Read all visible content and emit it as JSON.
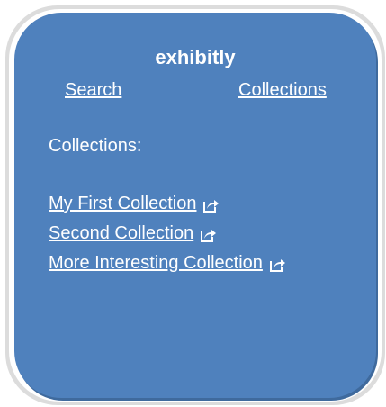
{
  "app": {
    "title": "exhibitly"
  },
  "nav": {
    "search_label": "Search",
    "collections_label": "Collections"
  },
  "section": {
    "label": "Collections:"
  },
  "collections": [
    {
      "label": "My First Collection",
      "icon": "external-link-icon"
    },
    {
      "label": "Second Collection",
      "icon": "external-link-icon"
    },
    {
      "label": "More Interesting Collection",
      "icon": "external-link-icon"
    }
  ],
  "colors": {
    "panel": "#4f81bd",
    "text": "#ffffff",
    "frame": "#dcdcdc"
  }
}
